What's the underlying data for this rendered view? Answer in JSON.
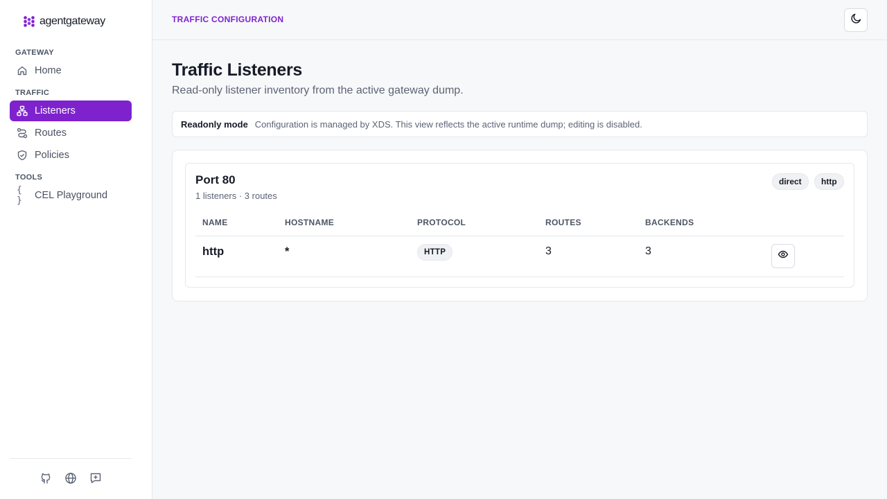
{
  "brand": {
    "name": "agentgateway",
    "accent": "#7e22ce"
  },
  "sidebar": {
    "sections": [
      {
        "label": "GATEWAY",
        "items": [
          {
            "label": "Home",
            "icon": "home-icon"
          }
        ]
      },
      {
        "label": "TRAFFIC",
        "items": [
          {
            "label": "Listeners",
            "icon": "network-icon",
            "active": true
          },
          {
            "label": "Routes",
            "icon": "route-icon"
          },
          {
            "label": "Policies",
            "icon": "shield-check-icon"
          }
        ]
      },
      {
        "label": "TOOLS",
        "items": [
          {
            "label": "CEL Playground",
            "icon": "braces-icon",
            "glyph": "{ }"
          }
        ]
      }
    ],
    "footer_icons": [
      "github-icon",
      "globe-icon",
      "feedback-icon"
    ]
  },
  "header": {
    "breadcrumb": "TRAFFIC CONFIGURATION",
    "theme_toggle_icon": "moon-icon"
  },
  "main": {
    "title": "Traffic Listeners",
    "subtitle": "Read-only listener inventory from the active gateway dump.",
    "readonly": {
      "title": "Readonly mode",
      "text": "Configuration is managed by XDS. This view reflects the active runtime dump; editing is disabled."
    },
    "port_group": {
      "title": "Port 80",
      "meta": "1 listeners · 3 routes",
      "tags": [
        "direct",
        "http"
      ],
      "columns": [
        "NAME",
        "HOSTNAME",
        "PROTOCOL",
        "ROUTES",
        "BACKENDS"
      ],
      "rows": [
        {
          "name": "http",
          "hostname": "*",
          "protocol": "HTTP",
          "routes": "3",
          "backends": "3",
          "action_icon": "eye-icon"
        }
      ]
    }
  }
}
